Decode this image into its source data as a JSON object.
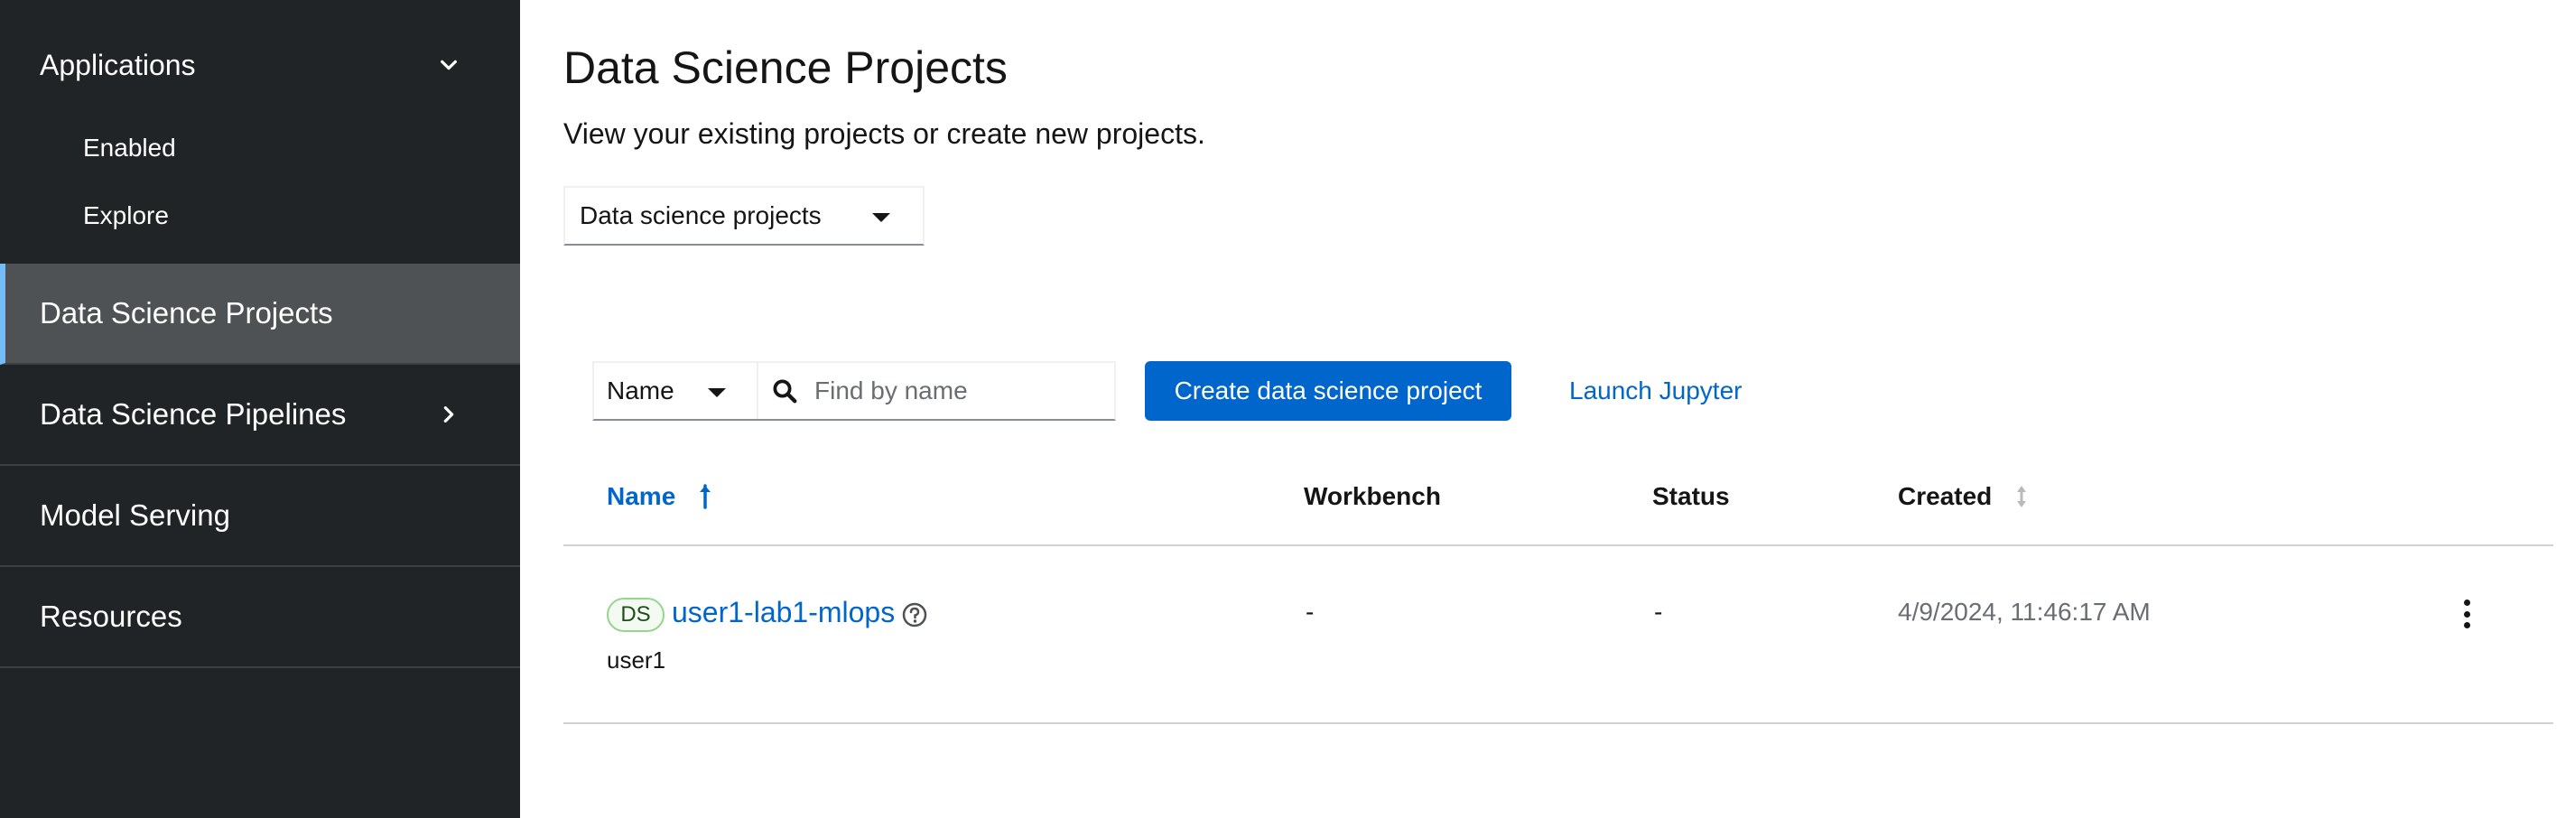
{
  "sidebar": {
    "group": {
      "label": "Applications",
      "items": [
        "Enabled",
        "Explore"
      ]
    },
    "items": [
      {
        "label": "Data Science Projects",
        "active": true
      },
      {
        "label": "Data Science Pipelines",
        "has_children": true
      },
      {
        "label": "Model Serving"
      },
      {
        "label": "Resources"
      }
    ]
  },
  "header": {
    "title": "Data Science Projects",
    "description": "View your existing projects or create new projects."
  },
  "project_filter": {
    "selected": "Data science projects"
  },
  "toolbar": {
    "filter_attribute": "Name",
    "search_placeholder": "Find by name",
    "create_label": "Create data science project",
    "launch_label": "Launch Jupyter"
  },
  "table": {
    "columns": [
      "Name",
      "Workbench",
      "Status",
      "Created"
    ],
    "rows": [
      {
        "badge": "DS",
        "name": "user1-lab1-mlops",
        "owner": "user1",
        "workbench": "-",
        "status": "-",
        "created": "4/9/2024, 11:46:17 AM"
      }
    ]
  },
  "colors": {
    "sidebar_bg": "#212427",
    "sidebar_active_bg": "#4f5255",
    "sidebar_active_accent": "#73bcf7",
    "primary": "#0066cc",
    "badge_border": "#95d58e"
  }
}
